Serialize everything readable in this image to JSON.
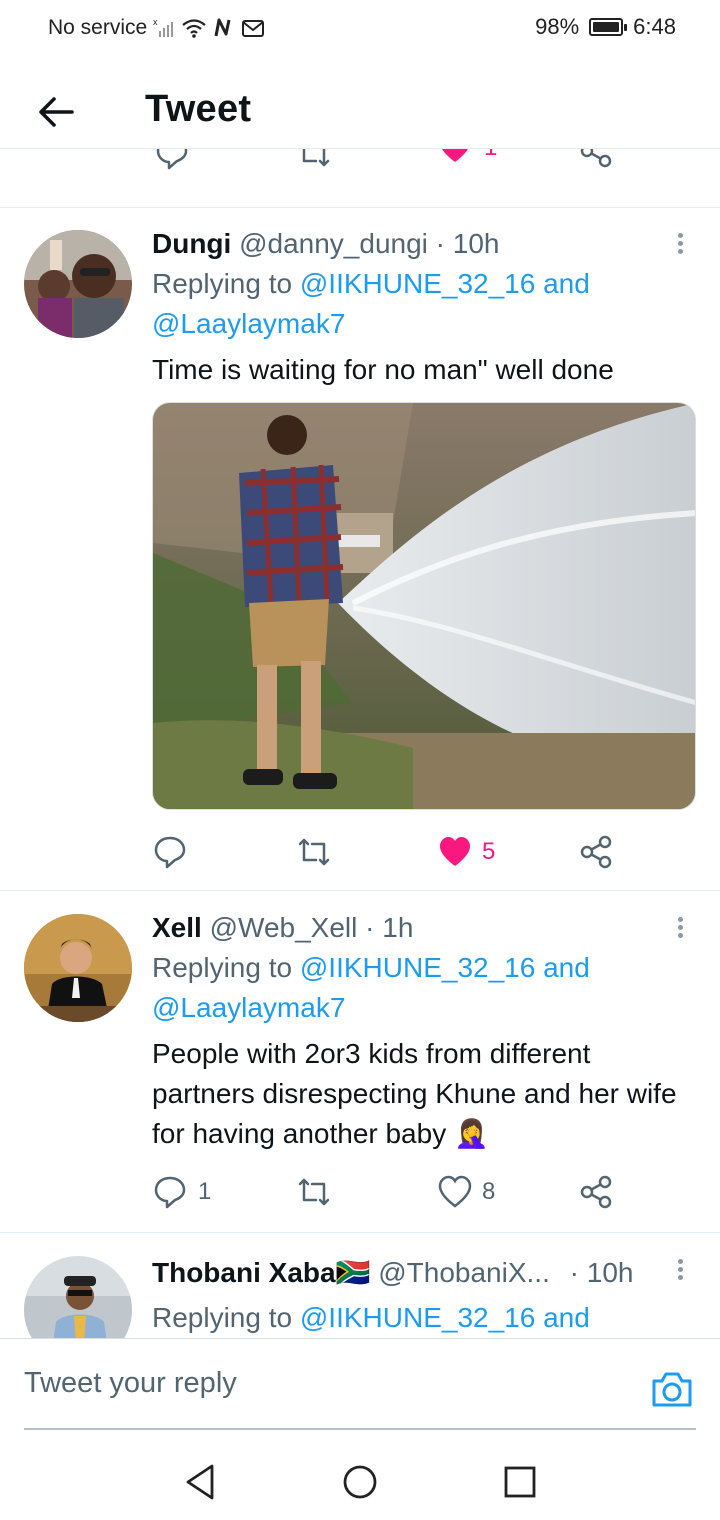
{
  "status_bar": {
    "carrier": "No service",
    "battery": "98%",
    "battery_level": 0.98,
    "time": "6:48",
    "icons": [
      "signal-icon",
      "wifi-icon",
      "nfc-icon",
      "gmail-icon",
      "battery-icon"
    ]
  },
  "header": {
    "title": "Tweet",
    "back_icon": "back-arrow-icon"
  },
  "previous_tweet_actions": {
    "like_count": "1",
    "like_color": "#f91880"
  },
  "tweets": [
    {
      "name": "Dungi",
      "handle": "@danny_dungi",
      "dot": "·",
      "time": "10h",
      "replying_prefix": "Replying to",
      "mention_1": "@IIKHUNE_32_16",
      "and": "and",
      "mention_2": "@Laaylaymak7",
      "text": "Time is waiting for no man\" well done",
      "has_media": true,
      "reply_count": "",
      "retweet_count": "",
      "like_count": "5",
      "liked": true
    },
    {
      "name": "Xell",
      "handle": "@Web_Xell",
      "dot": "·",
      "time": "1h",
      "replying_prefix": "Replying to",
      "mention_1": "@IIKHUNE_32_16",
      "and": "and",
      "mention_2": "@Laaylaymak7",
      "text": "People with 2or3 kids from different partners disrespecting Khune and her wife for having another baby 🤦‍♀️",
      "has_media": false,
      "reply_count": "1",
      "retweet_count": "",
      "like_count": "8",
      "liked": false
    },
    {
      "name": "Thobani Xaba",
      "flag": "🇿🇦",
      "handle": "@ThobaniX...",
      "dot": "·",
      "time": "10h",
      "replying_prefix": "Replying to",
      "mention_1": "@IIKHUNE_32_16",
      "and": "and"
    }
  ],
  "compose": {
    "placeholder": "Tweet your reply",
    "camera_icon": "camera-icon"
  },
  "colors": {
    "accent": "#1d9bf0",
    "like": "#f91880",
    "secondary_text": "#536471",
    "icon_gray": "#536471"
  },
  "nav_bar": {
    "icons": [
      "back-triangle-icon",
      "home-circle-icon",
      "recents-square-icon"
    ]
  }
}
